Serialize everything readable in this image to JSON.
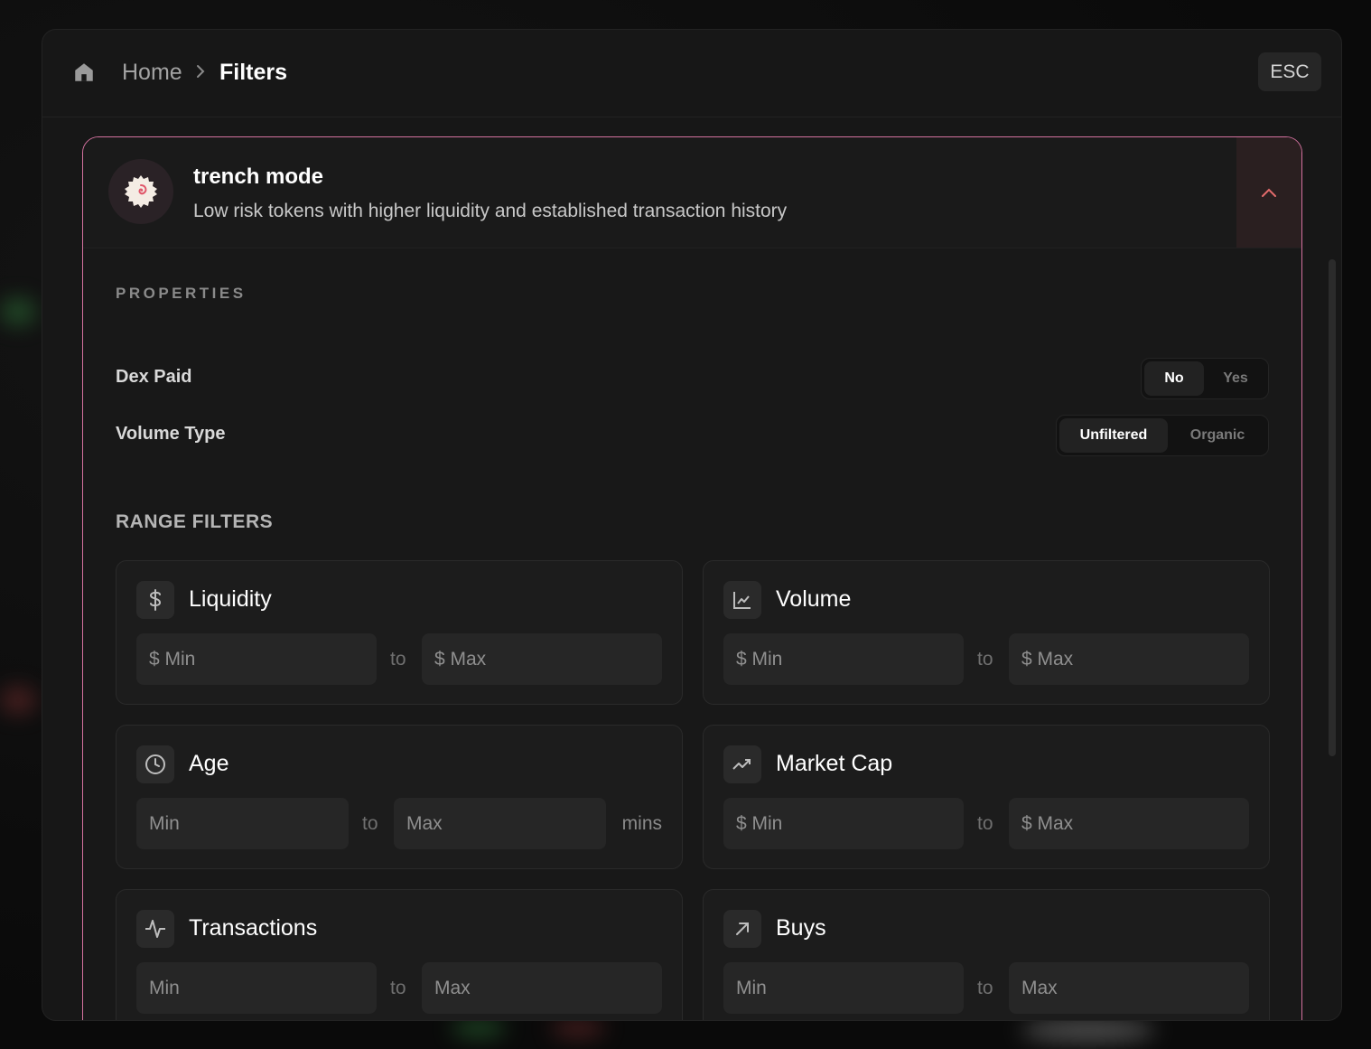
{
  "breadcrumb": {
    "home": "Home",
    "current": "Filters"
  },
  "header": {
    "esc_label": "ESC"
  },
  "preset": {
    "title": "trench mode",
    "description": "Low risk tokens with higher liquidity and established transaction history"
  },
  "properties": {
    "heading": "PROPERTIES",
    "dex_paid": {
      "label": "Dex Paid",
      "options": [
        "No",
        "Yes"
      ],
      "selected": "No"
    },
    "volume_type": {
      "label": "Volume Type",
      "options": [
        "Unfiltered",
        "Organic"
      ],
      "selected": "Unfiltered"
    }
  },
  "range": {
    "heading": "RANGE FILTERS",
    "to_label": "to",
    "liquidity": {
      "title": "Liquidity",
      "min": "$ Min",
      "max": "$ Max"
    },
    "volume": {
      "title": "Volume",
      "min": "$ Min",
      "max": "$ Max"
    },
    "age": {
      "title": "Age",
      "min": "Min",
      "max": "Max",
      "unit": "mins"
    },
    "market_cap": {
      "title": "Market Cap",
      "min": "$ Min",
      "max": "$ Max"
    },
    "transactions": {
      "title": "Transactions",
      "min": "Min",
      "max": "Max"
    },
    "buys": {
      "title": "Buys",
      "min": "Min",
      "max": "Max"
    }
  },
  "colors": {
    "accent_border": "#d4729f",
    "collapse_chevron": "#e26b6b"
  }
}
